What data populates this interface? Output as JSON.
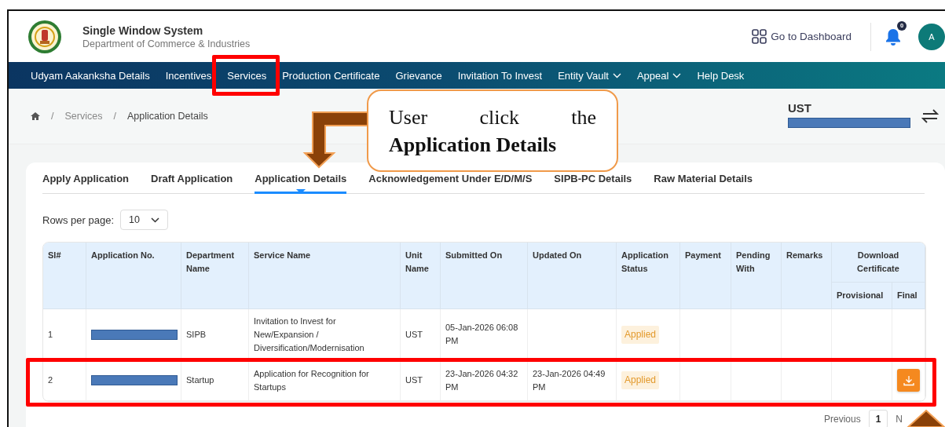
{
  "header": {
    "title": "Single Window System",
    "subtitle": "Department of Commerce & Industries",
    "dashboard_link": "Go to Dashboard",
    "notification_count": "0",
    "avatar_initial": "A"
  },
  "nav": [
    {
      "label": "Udyam Aakanksha Details",
      "has_menu": false
    },
    {
      "label": "Incentives",
      "has_menu": false
    },
    {
      "label": "Services",
      "has_menu": false
    },
    {
      "label": "Production Certificate",
      "has_menu": false
    },
    {
      "label": "Grievance",
      "has_menu": false
    },
    {
      "label": "Invitation To Invest",
      "has_menu": false
    },
    {
      "label": "Entity Vault",
      "has_menu": true
    },
    {
      "label": "Appeal",
      "has_menu": true
    },
    {
      "label": "Help Desk",
      "has_menu": false
    }
  ],
  "breadcrumb": {
    "separator": "/",
    "items": [
      "Services",
      "Application Details"
    ]
  },
  "unit": {
    "name": "UST"
  },
  "tabs": [
    {
      "label": "Apply Application",
      "selected": false
    },
    {
      "label": "Draft Application",
      "selected": false
    },
    {
      "label": "Application Details",
      "selected": true
    },
    {
      "label": "Acknowledgement Under E/D/M/S",
      "selected": false
    },
    {
      "label": "SIPB-PC Details",
      "selected": false
    },
    {
      "label": "Raw Material Details",
      "selected": false
    }
  ],
  "rows_per_page": {
    "label": "Rows per page:",
    "value": "10"
  },
  "table": {
    "columns": [
      "Sl#",
      "Application No.",
      "Department Name",
      "Service Name",
      "Unit Name",
      "Submitted On",
      "Updated On",
      "Application Status",
      "Payment",
      "Pending With",
      "Remarks"
    ],
    "group_column": {
      "label": "Download Certificate",
      "subcolumns": [
        "Provisional",
        "Final"
      ]
    },
    "rows": [
      {
        "sl": "1",
        "department": "SIPB",
        "service": "Invitation to Invest for New/Expansion / Diversification/Modernisation",
        "unit": "UST",
        "submitted": "05-Jan-2026 06:08 PM",
        "status": "Applied",
        "final_download": false
      },
      {
        "sl": "2",
        "department": "Startup",
        "service": "Application for Recognition for Startups",
        "unit": "UST",
        "submitted": "23-Jan-2026 04:32 PM",
        "updated": "23-Jan-2026 04:49 PM",
        "status": "Applied",
        "final_download": true
      }
    ]
  },
  "pagination": {
    "previous": "Previous",
    "pages": [
      {
        "label": "1",
        "selected": true
      }
    ],
    "next": "N"
  },
  "callout": {
    "text": "User click the **Application Details**"
  }
}
